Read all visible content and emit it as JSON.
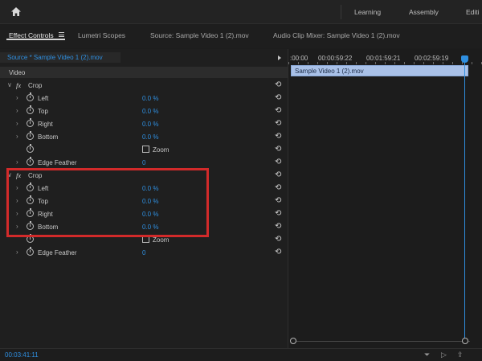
{
  "workspace": {
    "tabs": [
      "Learning",
      "Assembly",
      "Editi"
    ]
  },
  "panels": {
    "tabs": [
      {
        "label": "Effect Controls",
        "active": true
      },
      {
        "label": "Lumetri Scopes",
        "active": false
      },
      {
        "label": "Source: Sample Video 1 (2).mov",
        "active": false
      },
      {
        "label": "Audio Clip Mixer: Sample Video 1 (2).mov",
        "active": false
      }
    ]
  },
  "effect_controls": {
    "source_label": "Source * Sample Video 1 (2).mov",
    "section": "Video",
    "effects": [
      {
        "name": "Crop",
        "fx": "fx",
        "properties": [
          {
            "label": "Left",
            "value": "0.0 %"
          },
          {
            "label": "Top",
            "value": "0.0 %"
          },
          {
            "label": "Right",
            "value": "0.0 %"
          },
          {
            "label": "Bottom",
            "value": "0.0 %"
          }
        ],
        "zoom_label": "Zoom",
        "feather": {
          "label": "Edge Feather",
          "value": "0"
        }
      },
      {
        "name": "Crop",
        "fx": "fx",
        "properties": [
          {
            "label": "Left",
            "value": "0.0 %"
          },
          {
            "label": "Top",
            "value": "0.0 %"
          },
          {
            "label": "Right",
            "value": "0.0 %"
          },
          {
            "label": "Bottom",
            "value": "0.0 %"
          }
        ],
        "zoom_label": "Zoom",
        "feather": {
          "label": "Edge Feather",
          "value": "0"
        }
      }
    ]
  },
  "timeline": {
    "ruler_labels": [
      ":00:00",
      "00:00:59:22",
      "00:01:59:21",
      "00:02:59:19"
    ],
    "clip_label": "Sample Video 1 (2).mov"
  },
  "status": {
    "timecode": "00:03:41:11"
  },
  "colors": {
    "accent_blue": "#2f8fe0",
    "highlight_red": "#d22a2a",
    "clip_blue": "#a9c1e8"
  }
}
